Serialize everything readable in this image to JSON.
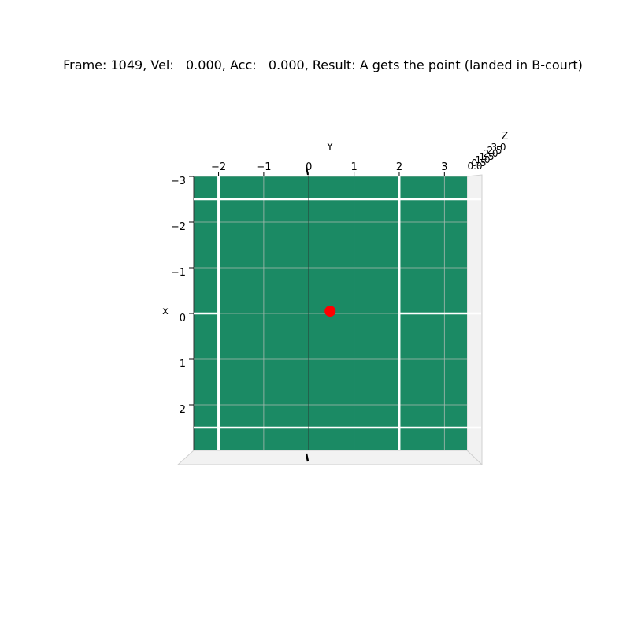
{
  "chart_data": {
    "type": "scatter",
    "title": "Frame: 1049, Vel:   0.000, Acc:   0.000, Result: A gets the point (landed in B-court)",
    "xlabel": "Y",
    "ylabel": "x",
    "zlabel": "Z",
    "x_ticks": [
      "−2",
      "−1",
      "0",
      "1",
      "2",
      "3"
    ],
    "y_ticks": [
      "−3",
      "−2",
      "−1",
      "0",
      "1",
      "2"
    ],
    "z_ticks": [
      "0.0",
      "0.5",
      "1.0",
      "1.5",
      "2.0",
      "2.5",
      "3.0"
    ],
    "xlim": [
      -2.55,
      3.5
    ],
    "ylim": [
      -3.0,
      3.0
    ],
    "grid": true,
    "court_color": "#1b8a64",
    "line_color": "#ffffff",
    "point_color": "#ff0000",
    "court_lines": {
      "sidelines_y": [
        -2.0,
        2.0
      ],
      "baselines_x": [
        -2.5,
        2.5
      ],
      "center_line_x": 0.0,
      "net_y": 0.0
    },
    "points": [
      {
        "y": 0.47,
        "x": -0.05,
        "label": "ball"
      }
    ]
  }
}
